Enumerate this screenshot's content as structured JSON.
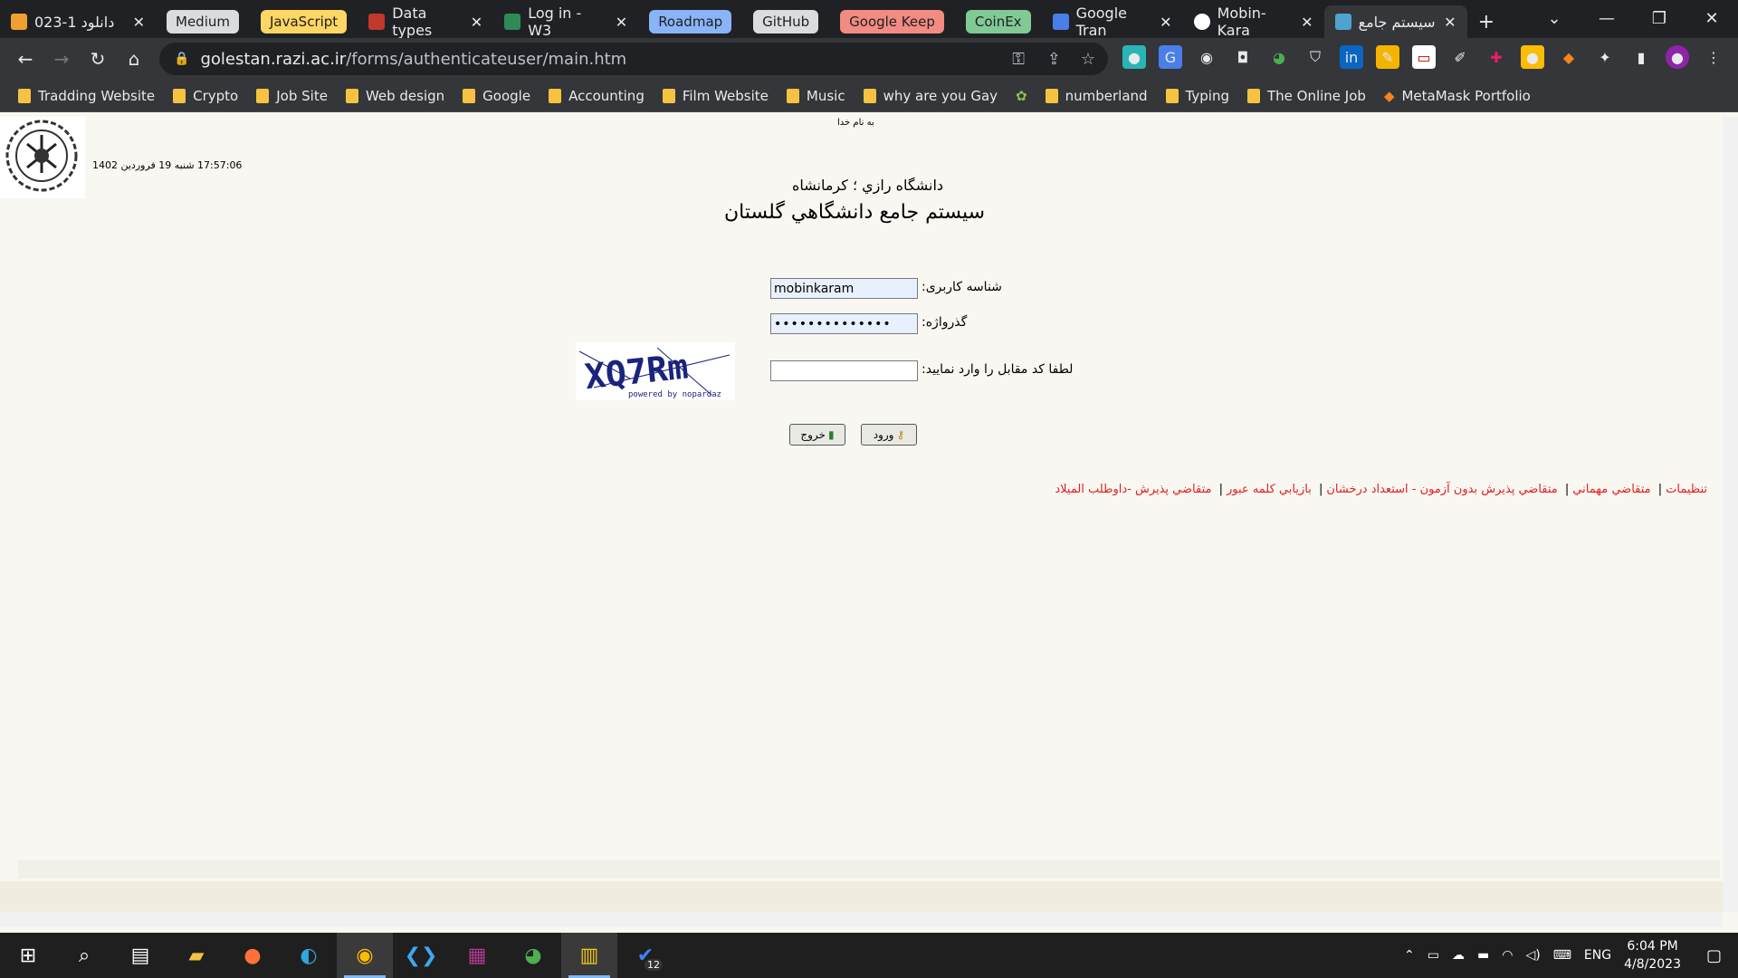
{
  "browser": {
    "tabs": [
      {
        "label": "دانلود 1-023",
        "color": "#f0a030"
      },
      {
        "label": "Data types",
        "color": "#c0392b"
      },
      {
        "label": "Log in - W3",
        "color": "#2e8b57"
      },
      {
        "label": "Google Tran",
        "color": "#4a7ee8"
      },
      {
        "label": "Mobin-Kara",
        "color": "#ffffff"
      },
      {
        "label": "سیستم جامع",
        "color": "#4fa3d1"
      }
    ],
    "groups": [
      {
        "label": "Medium",
        "bg": "#dadce0",
        "fg": "#202124"
      },
      {
        "label": "JavaScript",
        "bg": "#fdd663",
        "fg": "#202124"
      },
      {
        "label": "Roadmap",
        "bg": "#8ab4f8",
        "fg": "#202124"
      },
      {
        "label": "GitHub",
        "bg": "#dadce0",
        "fg": "#202124"
      },
      {
        "label": "Google Keep",
        "bg": "#f28b82",
        "fg": "#202124"
      },
      {
        "label": "CoinEx",
        "bg": "#81c995",
        "fg": "#202124"
      }
    ],
    "new_tab": "+",
    "url_host": "golestan.razi.ac.ir",
    "url_path": "/forms/authenticateuser/main.htm",
    "bookmarks": [
      "Tradding Website",
      "Crypto",
      "Job Site",
      "Web design",
      "Google",
      "Accounting",
      "Film Website",
      "Music",
      "why are you Gay",
      "numberland",
      "Typing",
      "The Online Job",
      "MetaMask Portfolio"
    ]
  },
  "page": {
    "bismillah": "به نام خدا",
    "datetime": "17:57:06 شنبه 19 فروردين 1402",
    "university": "دانشگاه رازي ؛ كرمانشاه",
    "system_title": "سيستم جامع دانشگاهي گلستان",
    "username_label": "شناسه کاربری:",
    "username_value": "mobinkaram",
    "password_label": "گذرواژه:",
    "password_value": "••••••••••••••",
    "captcha_label": "لطفا کد مقابل را وارد نمایید:",
    "captcha_value": "",
    "captcha_text": "XQ7Rm",
    "captcha_credit": "powered by nopardaz",
    "login_label": "ورود",
    "exit_label": "خروج",
    "links": [
      "تنظيمات",
      "متقاضي مهماني",
      "متقاضي پذيرش بدون آزمون - استعداد درخشان",
      "بازيابي كلمه عبور",
      "متقاضي پذيرش -داوطلب الميلاد"
    ]
  },
  "taskbar": {
    "lang": "ENG",
    "time": "6:04 PM",
    "date": "4/8/2023",
    "todo_badge": "12"
  }
}
